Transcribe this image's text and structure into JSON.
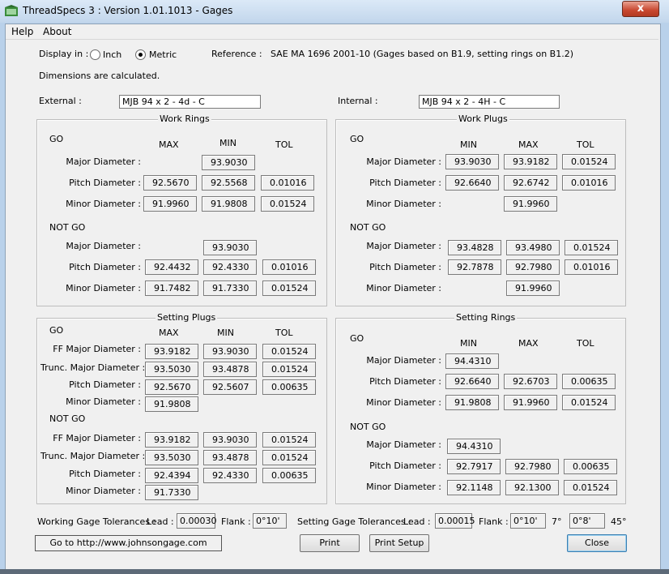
{
  "window": {
    "title": "ThreadSpecs 3 : Version 1.01.1013 - Gages",
    "close_glyph": "x"
  },
  "menu": {
    "help": "Help",
    "about": "About"
  },
  "display": {
    "label": "Display in :",
    "inch": "Inch",
    "metric": "Metric",
    "selected": "Metric"
  },
  "reference": {
    "label": "Reference :",
    "value": "SAE MA 1696 2001-10 (Gages based on B1.9, setting rings on B1.2)"
  },
  "calc_note": "Dimensions are calculated.",
  "external": {
    "label": "External :",
    "value": "MJB 94 x   2 - 4d - C"
  },
  "internal": {
    "label": "Internal :",
    "value": "MJB 94 x   2 - 4H - C"
  },
  "work_rings": {
    "title": "Work Rings",
    "go": "GO",
    "not_go": "NOT GO",
    "cols": {
      "max": "MAX",
      "min": "MIN",
      "tol": "TOL"
    },
    "go_rows": {
      "major": {
        "label": "Major Diameter :",
        "min": "93.9030"
      },
      "pitch": {
        "label": "Pitch Diameter :",
        "max": "92.5670",
        "min": "92.5568",
        "tol": "0.01016"
      },
      "minor": {
        "label": "Minor Diameter :",
        "max": "91.9960",
        "min": "91.9808",
        "tol": "0.01524"
      }
    },
    "notgo_rows": {
      "major": {
        "label": "Major Diameter :",
        "min": "93.9030"
      },
      "pitch": {
        "label": "Pitch Diameter :",
        "max": "92.4432",
        "min": "92.4330",
        "tol": "0.01016"
      },
      "minor": {
        "label": "Minor Diameter :",
        "max": "91.7482",
        "min": "91.7330",
        "tol": "0.01524"
      }
    }
  },
  "work_plugs": {
    "title": "Work Plugs",
    "go": "GO",
    "not_go": "NOT GO",
    "cols": {
      "min": "MIN",
      "max": "MAX",
      "tol": "TOL"
    },
    "go_rows": {
      "major": {
        "label": "Major Diameter :",
        "min": "93.9030",
        "max": "93.9182",
        "tol": "0.01524"
      },
      "pitch": {
        "label": "Pitch Diameter :",
        "min": "92.6640",
        "max": "92.6742",
        "tol": "0.01016"
      },
      "minor": {
        "label": "Minor Diameter :",
        "max": "91.9960"
      }
    },
    "notgo_rows": {
      "major": {
        "label": "Major Diameter :",
        "min": "93.4828",
        "max": "93.4980",
        "tol": "0.01524"
      },
      "pitch": {
        "label": "Pitch Diameter :",
        "min": "92.7878",
        "max": "92.7980",
        "tol": "0.01016"
      },
      "minor": {
        "label": "Minor Diameter :",
        "max": "91.9960"
      }
    }
  },
  "setting_plugs": {
    "title": "Setting Plugs",
    "go": "GO",
    "not_go": "NOT GO",
    "cols": {
      "max": "MAX",
      "min": "MIN",
      "tol": "TOL"
    },
    "go_rows": {
      "ff_major": {
        "label": "FF Major Diameter :",
        "max": "93.9182",
        "min": "93.9030",
        "tol": "0.01524"
      },
      "trunc_major": {
        "label": "Trunc. Major Diameter :",
        "max": "93.5030",
        "min": "93.4878",
        "tol": "0.01524"
      },
      "pitch": {
        "label": "Pitch Diameter :",
        "max": "92.5670",
        "min": "92.5607",
        "tol": "0.00635"
      },
      "minor": {
        "label": "Minor Diameter :",
        "max": "91.9808"
      }
    },
    "notgo_rows": {
      "ff_major": {
        "label": "FF Major Diameter :",
        "max": "93.9182",
        "min": "93.9030",
        "tol": "0.01524"
      },
      "trunc_major": {
        "label": "Trunc. Major Diameter :",
        "max": "93.5030",
        "min": "93.4878",
        "tol": "0.01524"
      },
      "pitch": {
        "label": "Pitch Diameter :",
        "max": "92.4394",
        "min": "92.4330",
        "tol": "0.00635"
      },
      "minor": {
        "label": "Minor Diameter :",
        "max": "91.7330"
      }
    }
  },
  "setting_rings": {
    "title": "Setting Rings",
    "go": "GO",
    "not_go": "NOT GO",
    "cols": {
      "min": "MIN",
      "max": "MAX",
      "tol": "TOL"
    },
    "go_rows": {
      "major": {
        "label": "Major Diameter :",
        "min": "94.4310"
      },
      "pitch": {
        "label": "Pitch Diameter :",
        "min": "92.6640",
        "max": "92.6703",
        "tol": "0.00635"
      },
      "minor": {
        "label": "Minor Diameter :",
        "min": "91.9808",
        "max": "91.9960",
        "tol": "0.01524"
      }
    },
    "notgo_rows": {
      "major": {
        "label": "Major Diameter :",
        "min": "94.4310"
      },
      "pitch": {
        "label": "Pitch Diameter :",
        "min": "92.7917",
        "max": "92.7980",
        "tol": "0.00635"
      },
      "minor": {
        "label": "Minor Diameter :",
        "min": "92.1148",
        "max": "92.1300",
        "tol": "0.01524"
      }
    }
  },
  "working_tol": {
    "label": "Working Gage Tolerances :",
    "lead_label": "Lead :",
    "lead": "0.00030",
    "flank_label": "Flank :",
    "flank": "0°10'"
  },
  "setting_tol": {
    "label": "Setting Gage Tolerances :",
    "lead_label": "Lead :",
    "lead": "0.00015",
    "flank_label": "Flank :",
    "flank1": "0°10'",
    "angle1": "7°",
    "flank2": "0°8'",
    "angle2": "45°"
  },
  "buttons": {
    "website": "Go to http://www.johnsongage.com",
    "print": "Print",
    "print_setup": "Print Setup",
    "close": "Close"
  }
}
